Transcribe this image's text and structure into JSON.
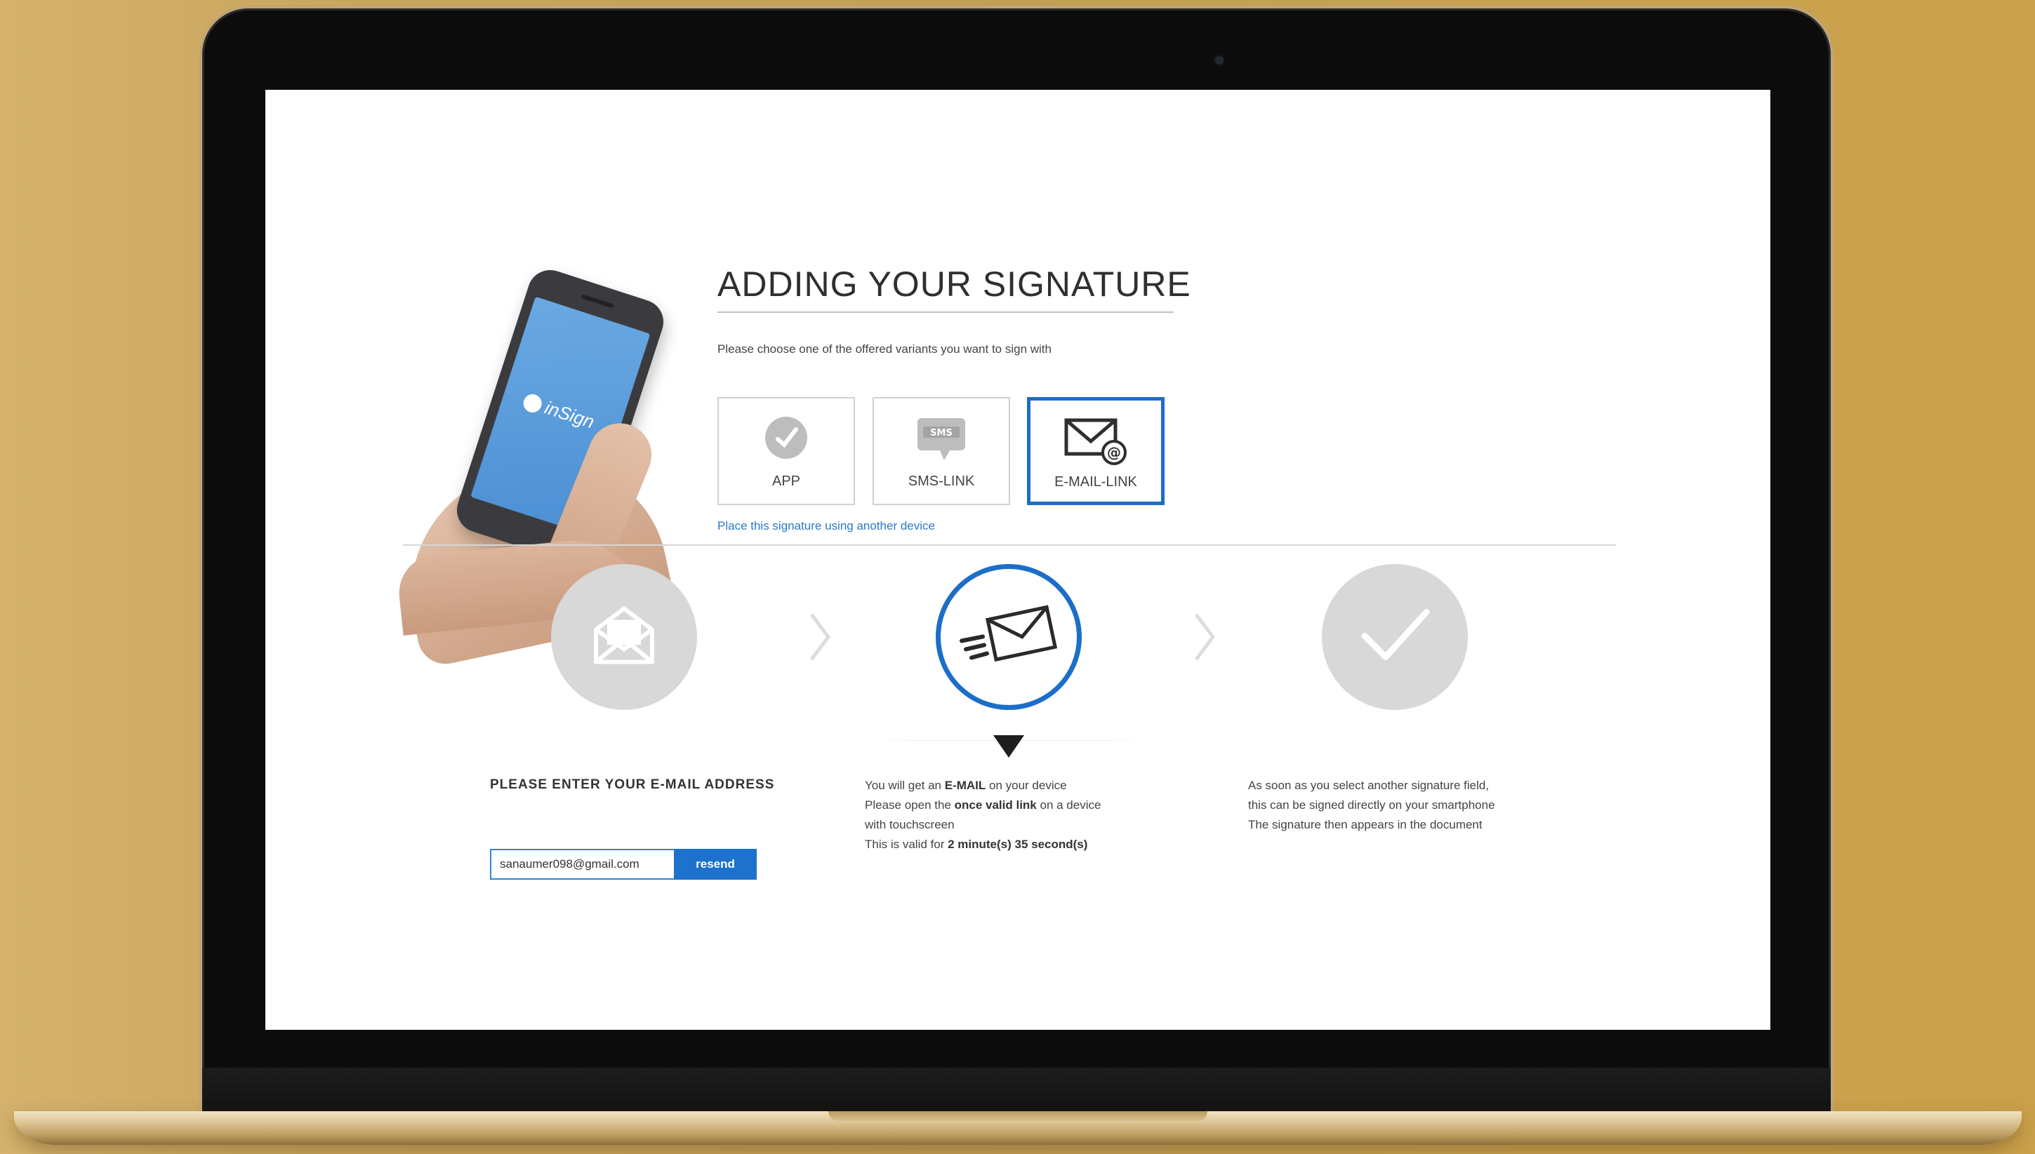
{
  "page": {
    "title": "ADDING YOUR SIGNATURE",
    "instruction": "Please choose one of the offered variants you want to sign with",
    "alt_device_link": "Place this signature using another device"
  },
  "phone": {
    "logo_text": "inSign"
  },
  "options": [
    {
      "label": "APP",
      "icon": "app-check-icon",
      "selected": false
    },
    {
      "label": "SMS-LINK",
      "icon": "sms-icon",
      "selected": false
    },
    {
      "label": "E-MAIL-LINK",
      "icon": "email-at-icon",
      "selected": true
    }
  ],
  "steps": {
    "icons": [
      "envelope-open-icon",
      "sending-envelope-icon",
      "checkmark-icon"
    ],
    "active_index": 1
  },
  "email_step": {
    "heading": "PLEASE ENTER YOUR E-MAIL ADDRESS",
    "input_value": "sanaumer098@gmail.com",
    "button_label": "resend"
  },
  "info_email": {
    "line1_pre": "You will get an ",
    "line1_bold": "E-MAIL",
    "line1_post": " on your device",
    "line2_pre": "Please open the ",
    "line2_bold": "once valid link",
    "line2_post": " on a device",
    "line3": "with touchscreen",
    "line4_pre": "This is valid for ",
    "line4_bold": "2 minute(s) 35 second(s)"
  },
  "info_final": {
    "line1": "As soon as you select another signature field,",
    "line2": "this can be signed directly on your smartphone",
    "line3": "The signature then appears in the document"
  },
  "colors": {
    "accent": "#1c6ec8",
    "inactive_step": "#d8d8d8",
    "background_gold": "#c39f55"
  }
}
